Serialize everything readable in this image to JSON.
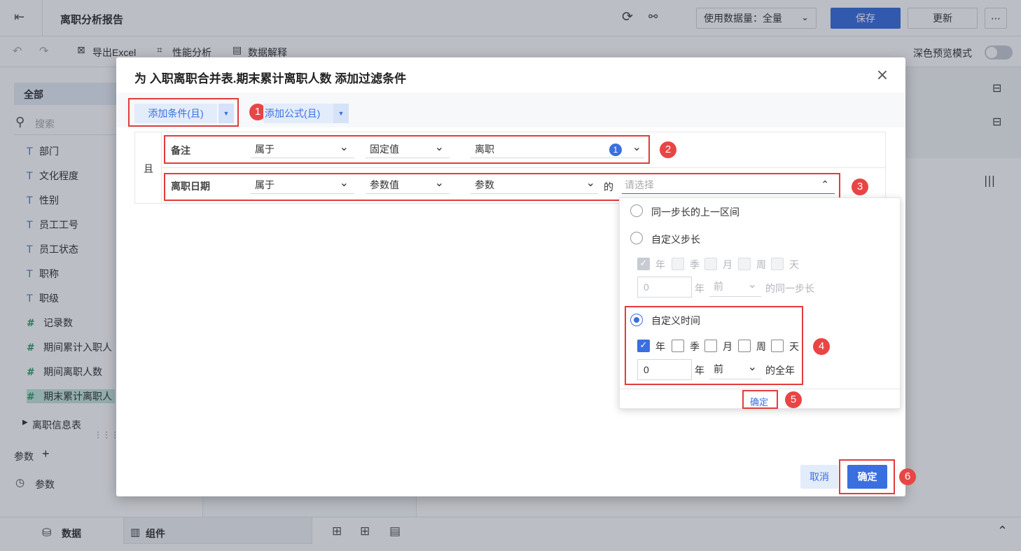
{
  "app": {
    "title": "离职分析报告",
    "data_usage_label": "使用数据量：全量",
    "save_label": "保存",
    "update_label": "更新",
    "more_label": "⋯"
  },
  "toolbar": {
    "export_excel": "导出Excel",
    "perf_analysis": "性能分析",
    "data_explain": "数据解释",
    "dark_preview": "深色预览模式"
  },
  "left_panel": {
    "all_label": "全部",
    "search_placeholder": "搜索",
    "fields": [
      {
        "type": "T",
        "name": "部门"
      },
      {
        "type": "T",
        "name": "文化程度"
      },
      {
        "type": "T",
        "name": "性别"
      },
      {
        "type": "T",
        "name": "员工工号"
      },
      {
        "type": "T",
        "name": "员工状态"
      },
      {
        "type": "T",
        "name": "职称"
      },
      {
        "type": "T",
        "name": "职级"
      },
      {
        "type": "#",
        "name": "记录数"
      },
      {
        "type": "#",
        "name": "期间累计入职人"
      },
      {
        "type": "#",
        "name": "期间离职人数"
      },
      {
        "type": "#",
        "name": "期末累计离职人"
      }
    ],
    "table_group": "离职信息表",
    "params_label": "参数",
    "params_add": "+",
    "param_item": "参数"
  },
  "bottom": {
    "data_tab": "数据",
    "component_tab": "组件"
  },
  "dialog": {
    "title": "为 入职离职合并表.期末累计离职人数 添加过滤条件",
    "close": "×",
    "add_condition": "添加条件(且)",
    "add_formula": "添加公式(且)",
    "dropdown_arrow": "▼",
    "logic_label": "且",
    "rows": [
      {
        "field": "备注",
        "operator": "属于",
        "value_type": "固定值",
        "value": "离职",
        "count": "1"
      },
      {
        "field": "离职日期",
        "operator": "属于",
        "value_type": "参数值",
        "value": "参数",
        "of_label": "的",
        "select_placeholder": "请选择"
      }
    ],
    "cancel": "取消",
    "confirm": "确定"
  },
  "popup": {
    "option1": "同一步长的上一区间",
    "option2": "自定义步长",
    "option3": "自定义时间",
    "units": [
      "年",
      "季",
      "月",
      "周",
      "天"
    ],
    "step_value": "0",
    "step_unit": "年",
    "step_dir": "前",
    "step_suffix": "的同一步长",
    "time_value": "0",
    "time_unit": "年",
    "time_dir": "前",
    "time_suffix": "的全年",
    "confirm": "确定"
  },
  "badges": [
    "1",
    "2",
    "3",
    "4",
    "5",
    "6"
  ],
  "colors": {
    "accent": "#3a6fe0",
    "highlight": "#e33c3c"
  }
}
